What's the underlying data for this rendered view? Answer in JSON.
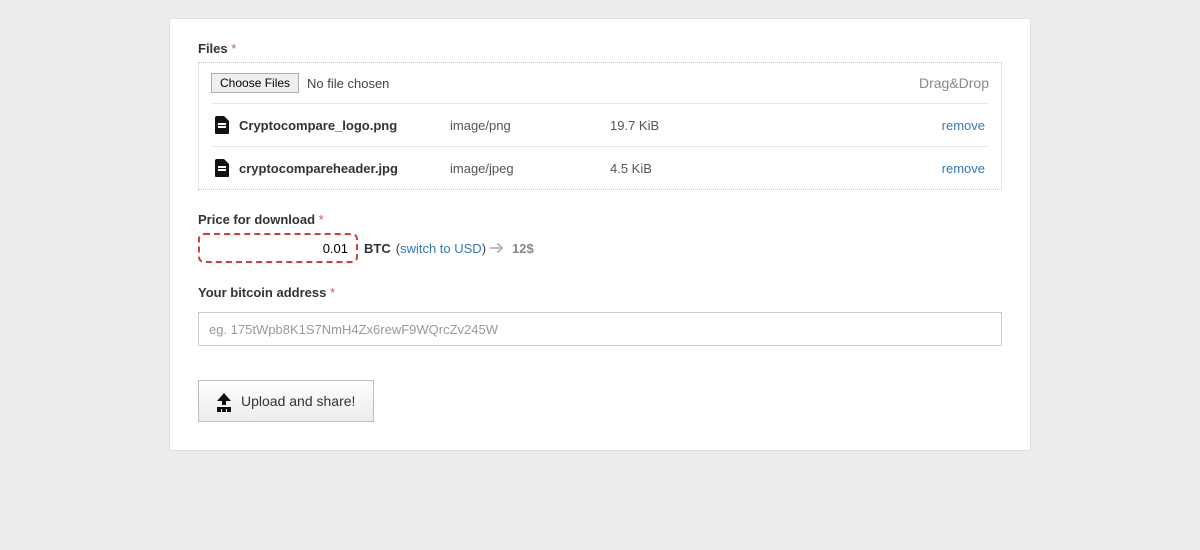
{
  "files": {
    "label": "Files",
    "chooseBtn": "Choose Files",
    "noFile": "No file chosen",
    "dragDrop": "Drag&Drop",
    "removeLabel": "remove",
    "items": [
      {
        "name": "Cryptocompare_logo.png",
        "type": "image/png",
        "size": "19.7 KiB"
      },
      {
        "name": "cryptocompareheader.jpg",
        "type": "image/jpeg",
        "size": "4.5 KiB"
      }
    ]
  },
  "price": {
    "label": "Price for download",
    "value": "0.01",
    "currency": "BTC",
    "switchText": "switch to USD",
    "usdEstimate": "12$"
  },
  "address": {
    "label": "Your bitcoin address",
    "placeholder": "eg. 175tWpb8K1S7NmH4Zx6rewF9WQrcZv245W"
  },
  "upload": {
    "label": "Upload and share!"
  }
}
